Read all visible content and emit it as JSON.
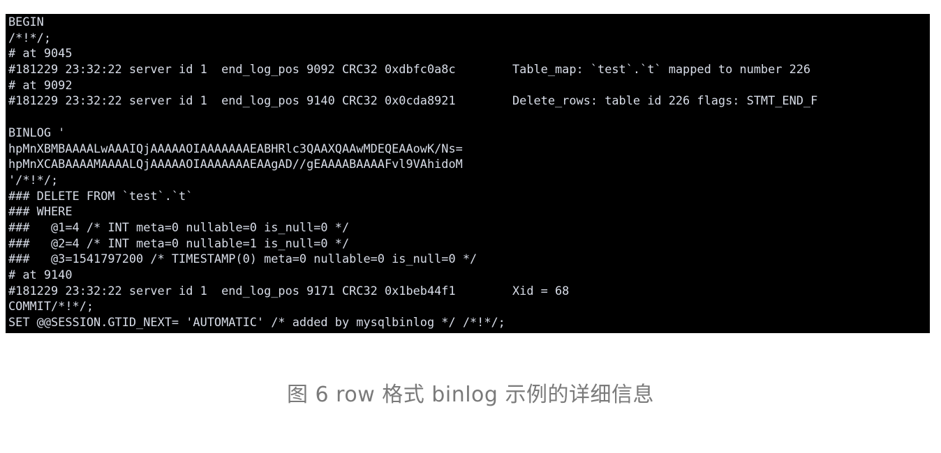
{
  "terminal": {
    "lines": [
      "BEGIN",
      "/*!*/;",
      "# at 9045",
      "#181229 23:32:22 server id 1  end_log_pos 9092 CRC32 0xdbfc0a8c        Table_map: `test`.`t` mapped to number 226",
      "# at 9092",
      "#181229 23:32:22 server id 1  end_log_pos 9140 CRC32 0x0cda8921        Delete_rows: table id 226 flags: STMT_END_F",
      "",
      "BINLOG '",
      "hpMnXBMBAAAALwAAAIQjAAAAAOIAAAAAAAEABHRlc3QAAXQAAwMDEQEAAowK/Ns=",
      "hpMnXCABAAAAMAAAALQjAAAAAOIAAAAAAAEAAgAD//gEAAAABAAAAFvl9VAhidoM",
      "'/*!*/;",
      "### DELETE FROM `test`.`t`",
      "### WHERE",
      "###   @1=4 /* INT meta=0 nullable=0 is_null=0 */",
      "###   @2=4 /* INT meta=0 nullable=1 is_null=0 */",
      "###   @3=1541797200 /* TIMESTAMP(0) meta=0 nullable=0 is_null=0 */",
      "# at 9140",
      "#181229 23:32:22 server id 1  end_log_pos 9171 CRC32 0x1beb44f1        Xid = 68",
      "COMMIT/*!*/;",
      "SET @@SESSION.GTID_NEXT= 'AUTOMATIC' /* added by mysqlbinlog */ /*!*/;"
    ]
  },
  "caption": "图 6 row 格式 binlog 示例的详细信息",
  "colors": {
    "terminal_background": "#000000",
    "terminal_text": "#d8dde8",
    "page_background": "#ffffff",
    "caption_text": "#7a7a7a"
  }
}
